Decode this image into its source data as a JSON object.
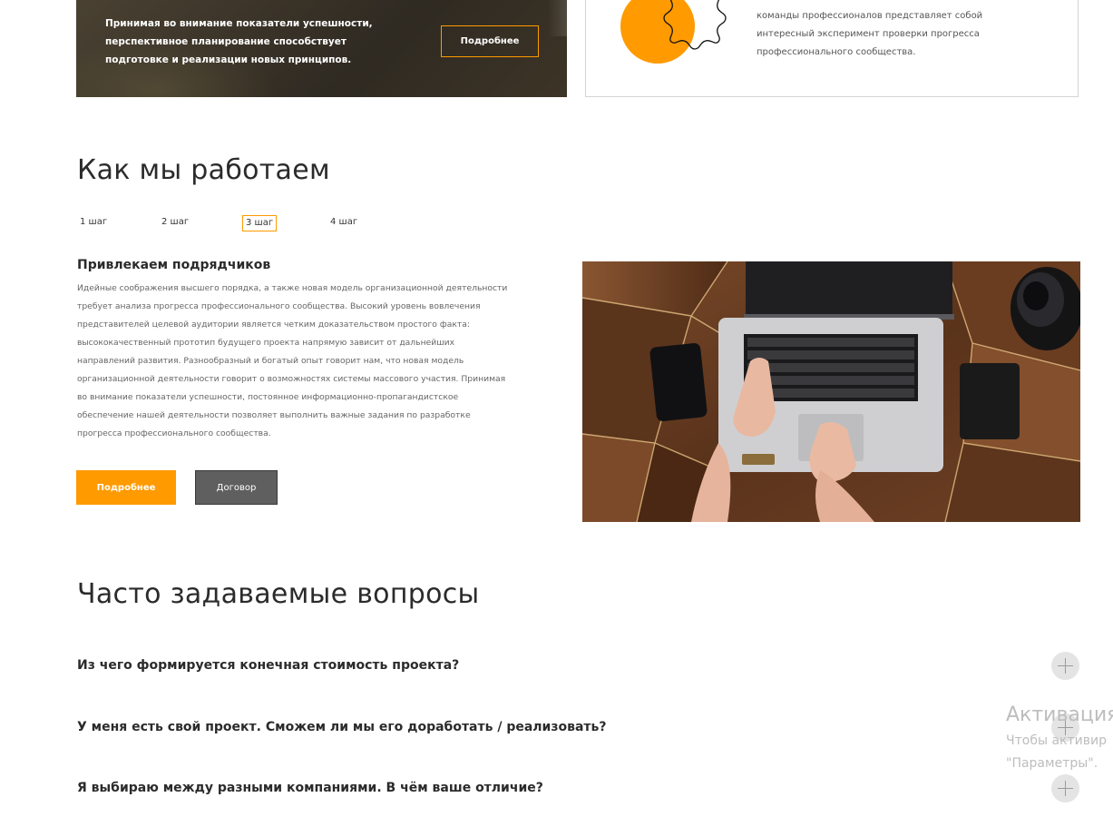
{
  "banner": {
    "text": "Принимая во внимание показатели успешности, перспективное планирование способствует подготовке и реализации новых принципов.",
    "button_label": "Подробнее"
  },
  "card": {
    "text": "команды профессионалов представляет собой интересный эксперимент проверки прогресса профессионального сообщества.",
    "accent_color": "#ff9a00"
  },
  "how": {
    "title": "Как мы работаем",
    "steps": [
      "1 шаг",
      "2 шаг",
      "3 шаг",
      "4 шаг"
    ],
    "active_step": "3 шаг",
    "heading": "Привлекаем подрядчиков",
    "text": "Идейные соображения высшего порядка, а также новая модель организационной деятельности требует анализа прогресса профессионального сообщества. Высокий уровень вовлечения представителей целевой аудитории является четким доказательством простого факта: высококачественный прототип будущего проекта напрямую зависит от дальнейших направлений развития. Разнообразный и богатый опыт говорит нам, что новая модель организационной деятельности говорит о возможностях системы массового участия. Принимая во внимание показатели успешности, постоянное информационно-пропагандистское обеспечение нашей деятельности позволяет выполнить важные задания по разработке прогресса профессионального сообщества.",
    "button_more": "Подробнее",
    "button_contract": "Договор"
  },
  "faq": {
    "title": "Часто задаваемые вопросы",
    "items": [
      "Из чего формируется конечная стоимость проекта?",
      "У меня есть свой проект. Сможем ли мы его доработать / реализовать?",
      "Я выбираю между разными компаниями. В чём ваше отличие?"
    ]
  },
  "watermark": {
    "line1": "Активация",
    "line2": "Чтобы активир",
    "line3": "\"Параметры\"."
  },
  "colors": {
    "accent": "#ff9a00",
    "dark_button": "#5f5f5f"
  }
}
